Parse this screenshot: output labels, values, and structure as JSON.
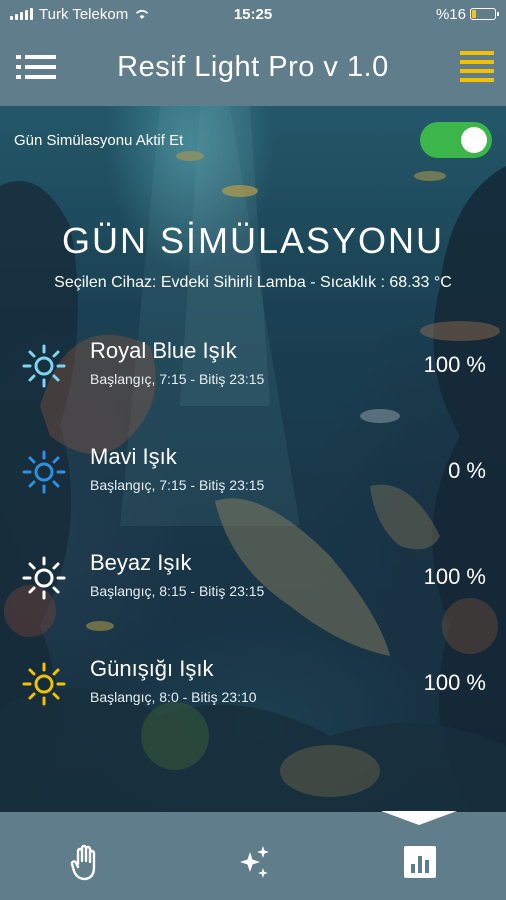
{
  "status_bar": {
    "carrier": "Turk Telekom",
    "time": "15:25",
    "battery": "%16",
    "battery_level": 0.16
  },
  "header": {
    "title": "Resif Light Pro v 1.0"
  },
  "simulation": {
    "toggle_label": "Gün Simülasyonu Aktif Et",
    "enabled": true,
    "title": "GÜN SİMÜLASYONU",
    "device_info": "Seçilen Cihaz: Evdeki Sihirli Lamba - Sıcaklık : 68.33 °C"
  },
  "lights": [
    {
      "name": "Royal Blue Işık",
      "schedule": "Başlangıç, 7:15 - Bitiş 23:15",
      "value": "100 %",
      "color": "#7fd4ee"
    },
    {
      "name": "Mavi Işık",
      "schedule": "Başlangıç, 7:15 - Bitiş 23:15",
      "value": "0 %",
      "color": "#2f8fe0"
    },
    {
      "name": "Beyaz Işık",
      "schedule": "Başlangıç, 8:15 - Bitiş 23:15",
      "value": "100 %",
      "color": "#ffffff"
    },
    {
      "name": "Günışığı Işık",
      "schedule": "Başlangıç, 8:0 - Bitiş 23:10",
      "value": "100 %",
      "color": "#f2c200"
    }
  ],
  "bottom_nav": {
    "items": [
      "hand-icon",
      "sparkles-icon",
      "chart-icon"
    ],
    "active": "chart-icon"
  },
  "colors": {
    "bar": "#607d8b",
    "toggle_on": "#3cb54a",
    "menu_accent": "#f2c200"
  }
}
